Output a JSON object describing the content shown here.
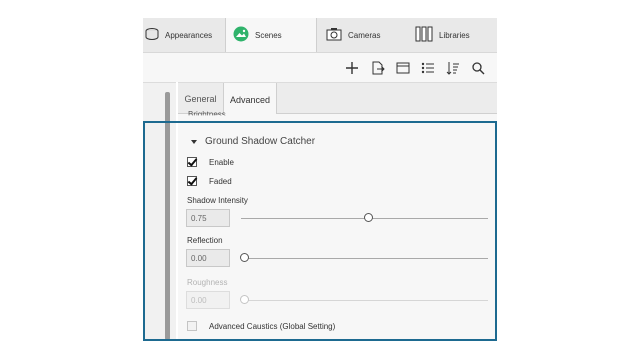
{
  "tabs": [
    {
      "label": "Appearances",
      "icon": "appearances-icon",
      "active": false
    },
    {
      "label": "Scenes",
      "icon": "scenes-icon",
      "active": true
    },
    {
      "label": "Cameras",
      "icon": "camera-icon",
      "active": false
    },
    {
      "label": "Libraries",
      "icon": "libraries-icon",
      "active": false
    }
  ],
  "toolbar": {
    "icons": [
      "add-icon",
      "export-icon",
      "window-icon",
      "list-settings-icon",
      "sort-icon",
      "search-icon"
    ]
  },
  "subtabs": [
    {
      "label": "General",
      "active": false
    },
    {
      "label": "Advanced",
      "active": true
    }
  ],
  "panel": {
    "cut_label": "Brightness",
    "section_title": "Ground Shadow Catcher",
    "enable": {
      "label": "Enable",
      "checked": true
    },
    "faded": {
      "label": "Faded",
      "checked": true
    },
    "shadow_intensity": {
      "label": "Shadow Intensity",
      "value": "0.75",
      "fraction": 0.5
    },
    "reflection": {
      "label": "Reflection",
      "value": "0.00",
      "fraction": 0.0
    },
    "roughness": {
      "label": "Roughness",
      "value": "0.00",
      "fraction": 0.0,
      "disabled": true
    },
    "advanced_caustics": {
      "label": "Advanced Caustics (Global Setting)",
      "checked": false,
      "disabled": true
    }
  },
  "colors": {
    "highlight_border": "#1d6a90",
    "scenes_icon": "#2fb36b"
  }
}
